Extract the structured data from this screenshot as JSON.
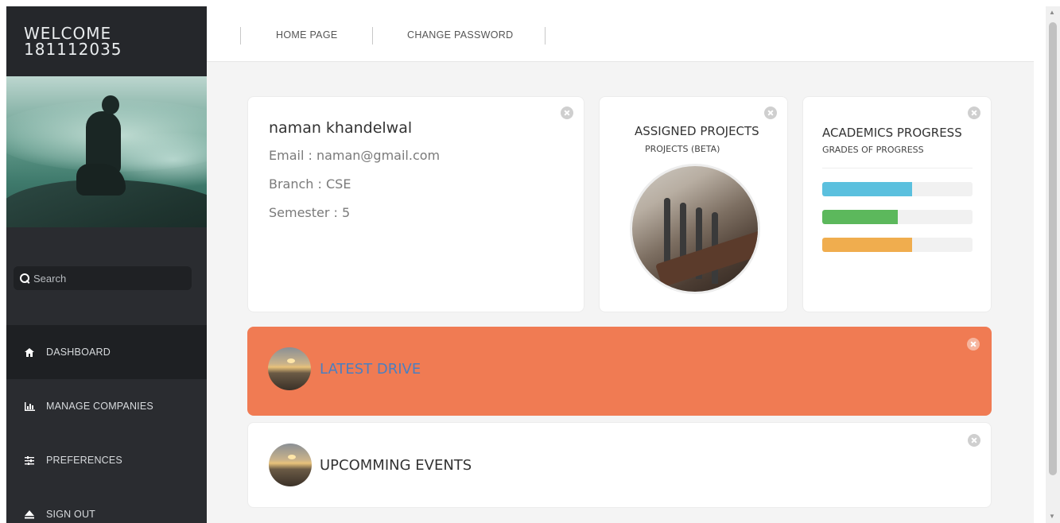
{
  "sidebar": {
    "welcome_line1": "WELCOME",
    "welcome_line2": "181112035",
    "search_placeholder": "Search",
    "items": [
      {
        "label": "DASHBOARD",
        "icon": "home-icon",
        "active": true
      },
      {
        "label": "MANAGE COMPANIES",
        "icon": "bar-chart-icon",
        "active": false
      },
      {
        "label": "PREFERENCES",
        "icon": "sliders-icon",
        "active": false
      },
      {
        "label": "SIGN OUT",
        "icon": "eject-icon",
        "active": false
      }
    ]
  },
  "topbar": {
    "links": [
      "HOME PAGE",
      "CHANGE PASSWORD"
    ]
  },
  "profile": {
    "name": "naman khandelwal",
    "email": "Email : naman@gmail.com",
    "branch": "Branch : CSE",
    "semester": "Semester : 5"
  },
  "projects": {
    "title": "ASSIGNED PROJECTS",
    "subtitle": "PROJECTS (BETA)"
  },
  "academics": {
    "title": "ACADEMICS PROGRESS",
    "subtitle": "GRADES OF PROGRESS",
    "bars": [
      {
        "percent": 60,
        "color": "#5bc0de"
      },
      {
        "percent": 50,
        "color": "#5cb85c"
      },
      {
        "percent": 60,
        "color": "#f0ad4e"
      }
    ]
  },
  "latest_drive": {
    "title": "LATEST DRIVE",
    "background": "#f07b53",
    "title_color": "#4a7fc1"
  },
  "upcoming_events": {
    "title": "UPCOMMING EVENTS"
  }
}
